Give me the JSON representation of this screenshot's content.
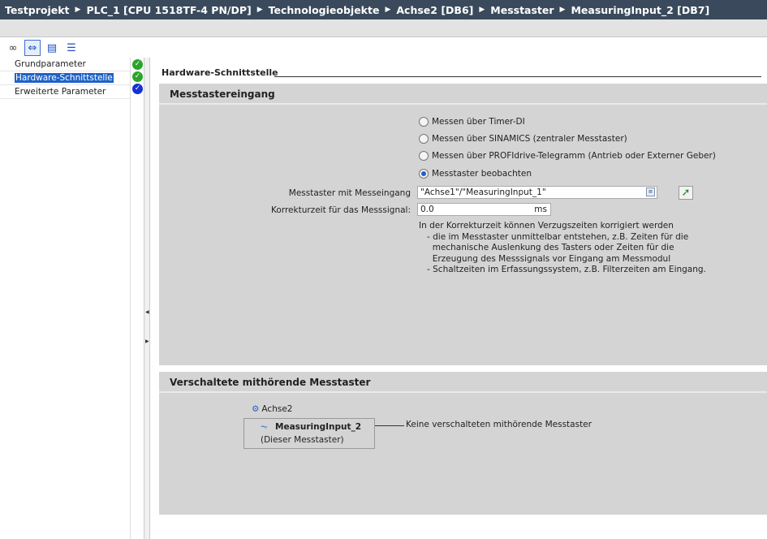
{
  "breadcrumb": [
    "Testprojekt",
    "PLC_1 [CPU 1518TF-4 PN/DP]",
    "Technologieobjekte",
    "Achse2 [DB6]",
    "Messtaster",
    "MeasuringInput_2 [DB7]"
  ],
  "nav": [
    {
      "label": "Grundparameter",
      "status": "ok",
      "color": "#2aa52a"
    },
    {
      "label": "Hardware-Schnittstelle",
      "status": "ok",
      "color": "#2aa52a",
      "selected": true
    },
    {
      "label": "Erweiterte Parameter",
      "status": "ok",
      "color": "#1430d6"
    }
  ],
  "main": {
    "title": "Hardware-Schnittstelle",
    "section1": {
      "title": "Messtastereingang",
      "options": [
        {
          "label": "Messen über Timer-DI",
          "checked": false
        },
        {
          "label": "Messen über SINAMICS (zentraler Messtaster)",
          "checked": false
        },
        {
          "label": "Messen über PROFIdrive-Telegramm (Antrieb oder Externer Geber)",
          "checked": false
        },
        {
          "label": "Messtaster beobachten",
          "checked": true
        }
      ],
      "input_label": "Messtaster mit Messeingang",
      "input_value": "\"Achse1\"/\"MeasuringInput_1\"",
      "korr_label": "Korrekturzeit für das Messsignal:",
      "korr_value": "0.0",
      "korr_unit": "ms",
      "hint": "In der Korrekturzeit können Verzugszeiten korrigiert werden\n   - die im Messtaster unmittelbar entstehen, z.B. Zeiten für die\n     mechanische Auslenkung des Tasters oder Zeiten für die\n     Erzeugung des Messsignals vor Eingang am Messmodul\n   - Schaltzeiten im Erfassungssystem, z.B. Filterzeiten am Eingang."
    },
    "section2": {
      "title": "Verschaltete mithörende Messtaster",
      "axis": "Achse2",
      "node": "MeasuringInput_2",
      "node_sub": "(Dieser Messtaster)",
      "none_text": "Keine verschalteten mithörende Messtaster"
    }
  }
}
